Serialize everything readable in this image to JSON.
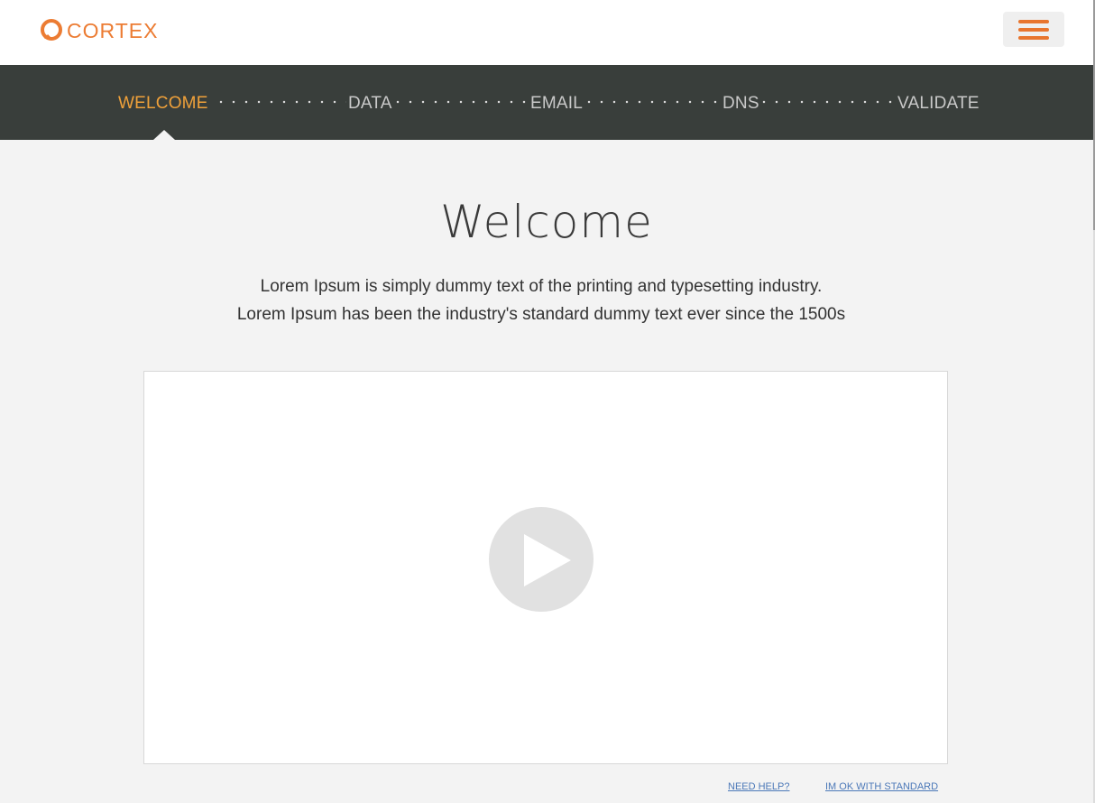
{
  "brand": {
    "name": "CORTEX",
    "color": "#ec7c33"
  },
  "header": {
    "menu_icon": "hamburger-menu-icon"
  },
  "steps": {
    "items": [
      {
        "label": "WELCOME",
        "active": true
      },
      {
        "label": "DATA",
        "active": false
      },
      {
        "label": "EMAIL",
        "active": false
      },
      {
        "label": "DNS",
        "active": false
      },
      {
        "label": "VALIDATE",
        "active": false
      }
    ],
    "active_color": "#f0a13a",
    "bar_color": "#393e3b"
  },
  "main": {
    "title": "Welcome",
    "subtitle_line1": "Lorem Ipsum is simply dummy text of the printing and typesetting industry.",
    "subtitle_line2": "Lorem Ipsum has been the industry's standard dummy text ever since the 1500s"
  },
  "video": {
    "icon": "play-icon"
  },
  "links": {
    "help": "NEED HELP?",
    "standard": "IM OK WITH STANDARD"
  }
}
